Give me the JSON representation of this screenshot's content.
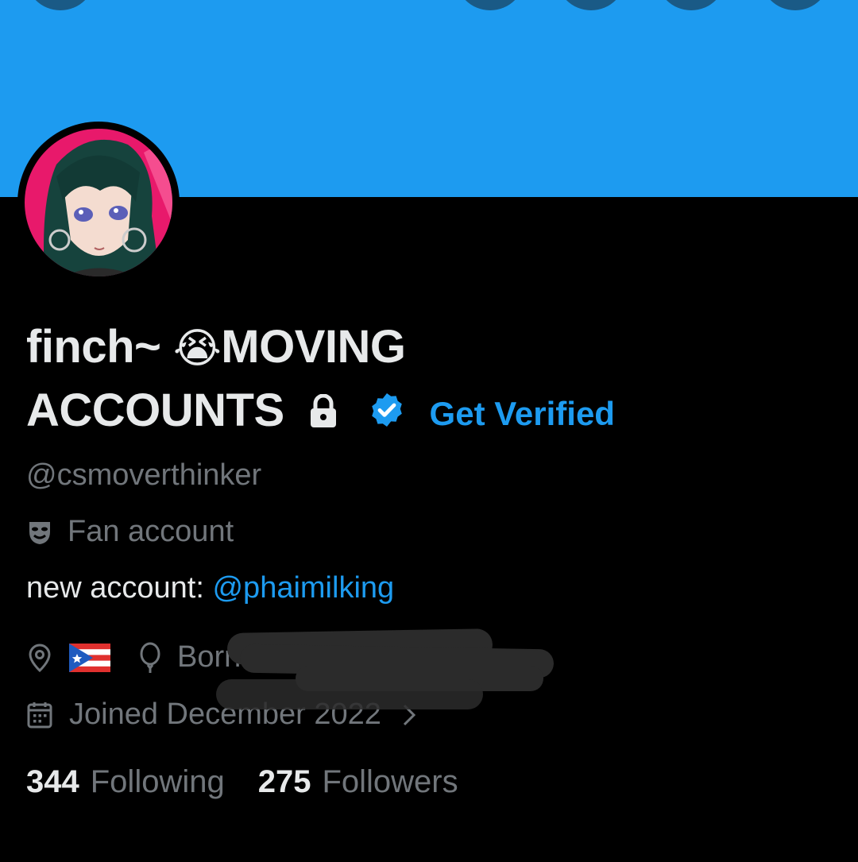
{
  "profile": {
    "name_line1": "finch~ ",
    "name_emoji": "😭",
    "name_line1b": "MOVING",
    "name_line2": "ACCOUNTS",
    "get_verified": "Get Verified",
    "handle": "@csmoverthinker",
    "category": "Fan account",
    "bio_prefix": "new account: ",
    "bio_mention": "@phaimilking",
    "born_label": "Born",
    "joined": "Joined December 2022",
    "following_count": "344",
    "following_label": "Following",
    "followers_count": "275",
    "followers_label": "Followers"
  },
  "icons": {
    "lock": "lock-icon",
    "verified": "verified-badge-icon",
    "category": "theater-masks-icon",
    "location": "location-pin-icon",
    "flag": "puerto-rico-flag-icon",
    "birthday": "balloon-icon",
    "calendar": "calendar-icon",
    "chevron": "chevron-right-icon"
  },
  "colors": {
    "banner": "#1d9bf0",
    "accent": "#1d9bf0",
    "text_primary": "#e7e9ea",
    "text_secondary": "#71767b",
    "background": "#000000"
  }
}
